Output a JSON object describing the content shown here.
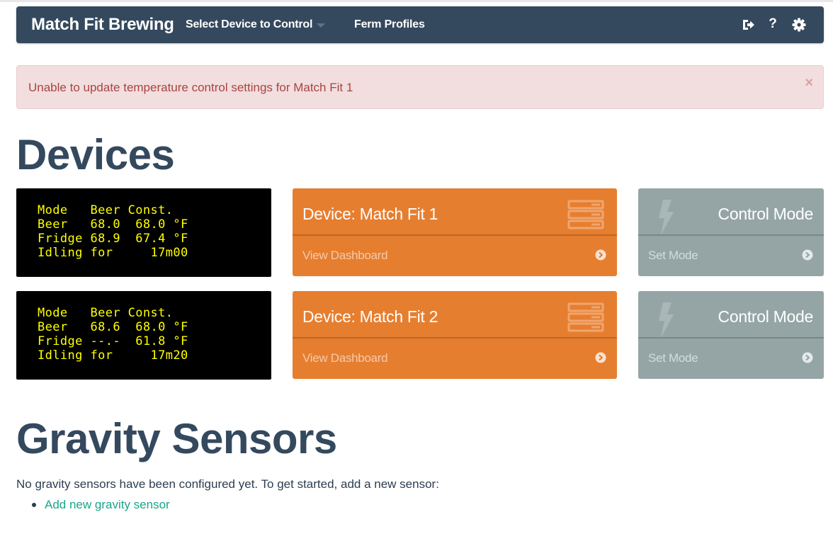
{
  "navbar": {
    "brand": "Match Fit Brewing",
    "select_device": "Select Device to Control",
    "ferm_profiles": "Ferm Profiles",
    "icons": [
      "logout-icon",
      "help-icon",
      "gear-icon"
    ],
    "help_glyph": "?"
  },
  "alert": {
    "message": "Unable to update temperature control settings for Match Fit 1",
    "close": "×"
  },
  "devices_heading": "Devices",
  "devices": [
    {
      "lcd": [
        "Mode   Beer Const.",
        "Beer   68.0  68.0 °F",
        "Fridge 68.9  67.4 °F",
        "Idling for     17m00"
      ],
      "title": "Device: Match Fit 1",
      "dashboard_link": "View Dashboard",
      "control_title": "Control Mode",
      "control_link": "Set Mode"
    },
    {
      "lcd": [
        "Mode   Beer Const.",
        "Beer   68.6  68.0 °F",
        "Fridge --.-  61.8 °F",
        "Idling for     17m20"
      ],
      "title": "Device: Match Fit 2",
      "dashboard_link": "View Dashboard",
      "control_title": "Control Mode",
      "control_link": "Set Mode"
    }
  ],
  "gravity": {
    "heading": "Gravity Sensors",
    "text": "No gravity sensors have been configured yet. To get started, add a new sensor:",
    "add_link": "Add new gravity sensor"
  },
  "colors": {
    "navbar": "#34495e",
    "orange_panel": "#e67e30",
    "grey_panel": "#95a5a6",
    "lcd_text": "#ffff00",
    "alert_bg": "#f2dede",
    "alert_text": "#a94442",
    "link": "#18a689"
  }
}
